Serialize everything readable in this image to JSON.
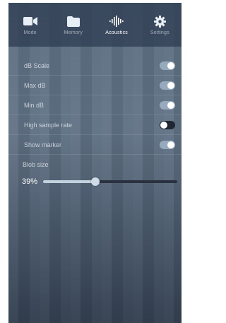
{
  "tabs": [
    {
      "label": "Mode",
      "icon": "video-camera-icon",
      "active": false
    },
    {
      "label": "Memory",
      "icon": "folder-icon",
      "active": false
    },
    {
      "label": "Acoustics",
      "icon": "waveform-icon",
      "active": true
    },
    {
      "label": "Settings",
      "icon": "gear-icon",
      "active": false
    }
  ],
  "settings": [
    {
      "label": "dB Scale",
      "on": true
    },
    {
      "label": "Max dB",
      "on": true
    },
    {
      "label": "Min dB",
      "on": true
    },
    {
      "label": "High sample rate",
      "on": false
    },
    {
      "label": "Show marker",
      "on": true
    }
  ],
  "blob_size": {
    "label": "Blob size",
    "value_text": "39%",
    "value": 0.39
  }
}
